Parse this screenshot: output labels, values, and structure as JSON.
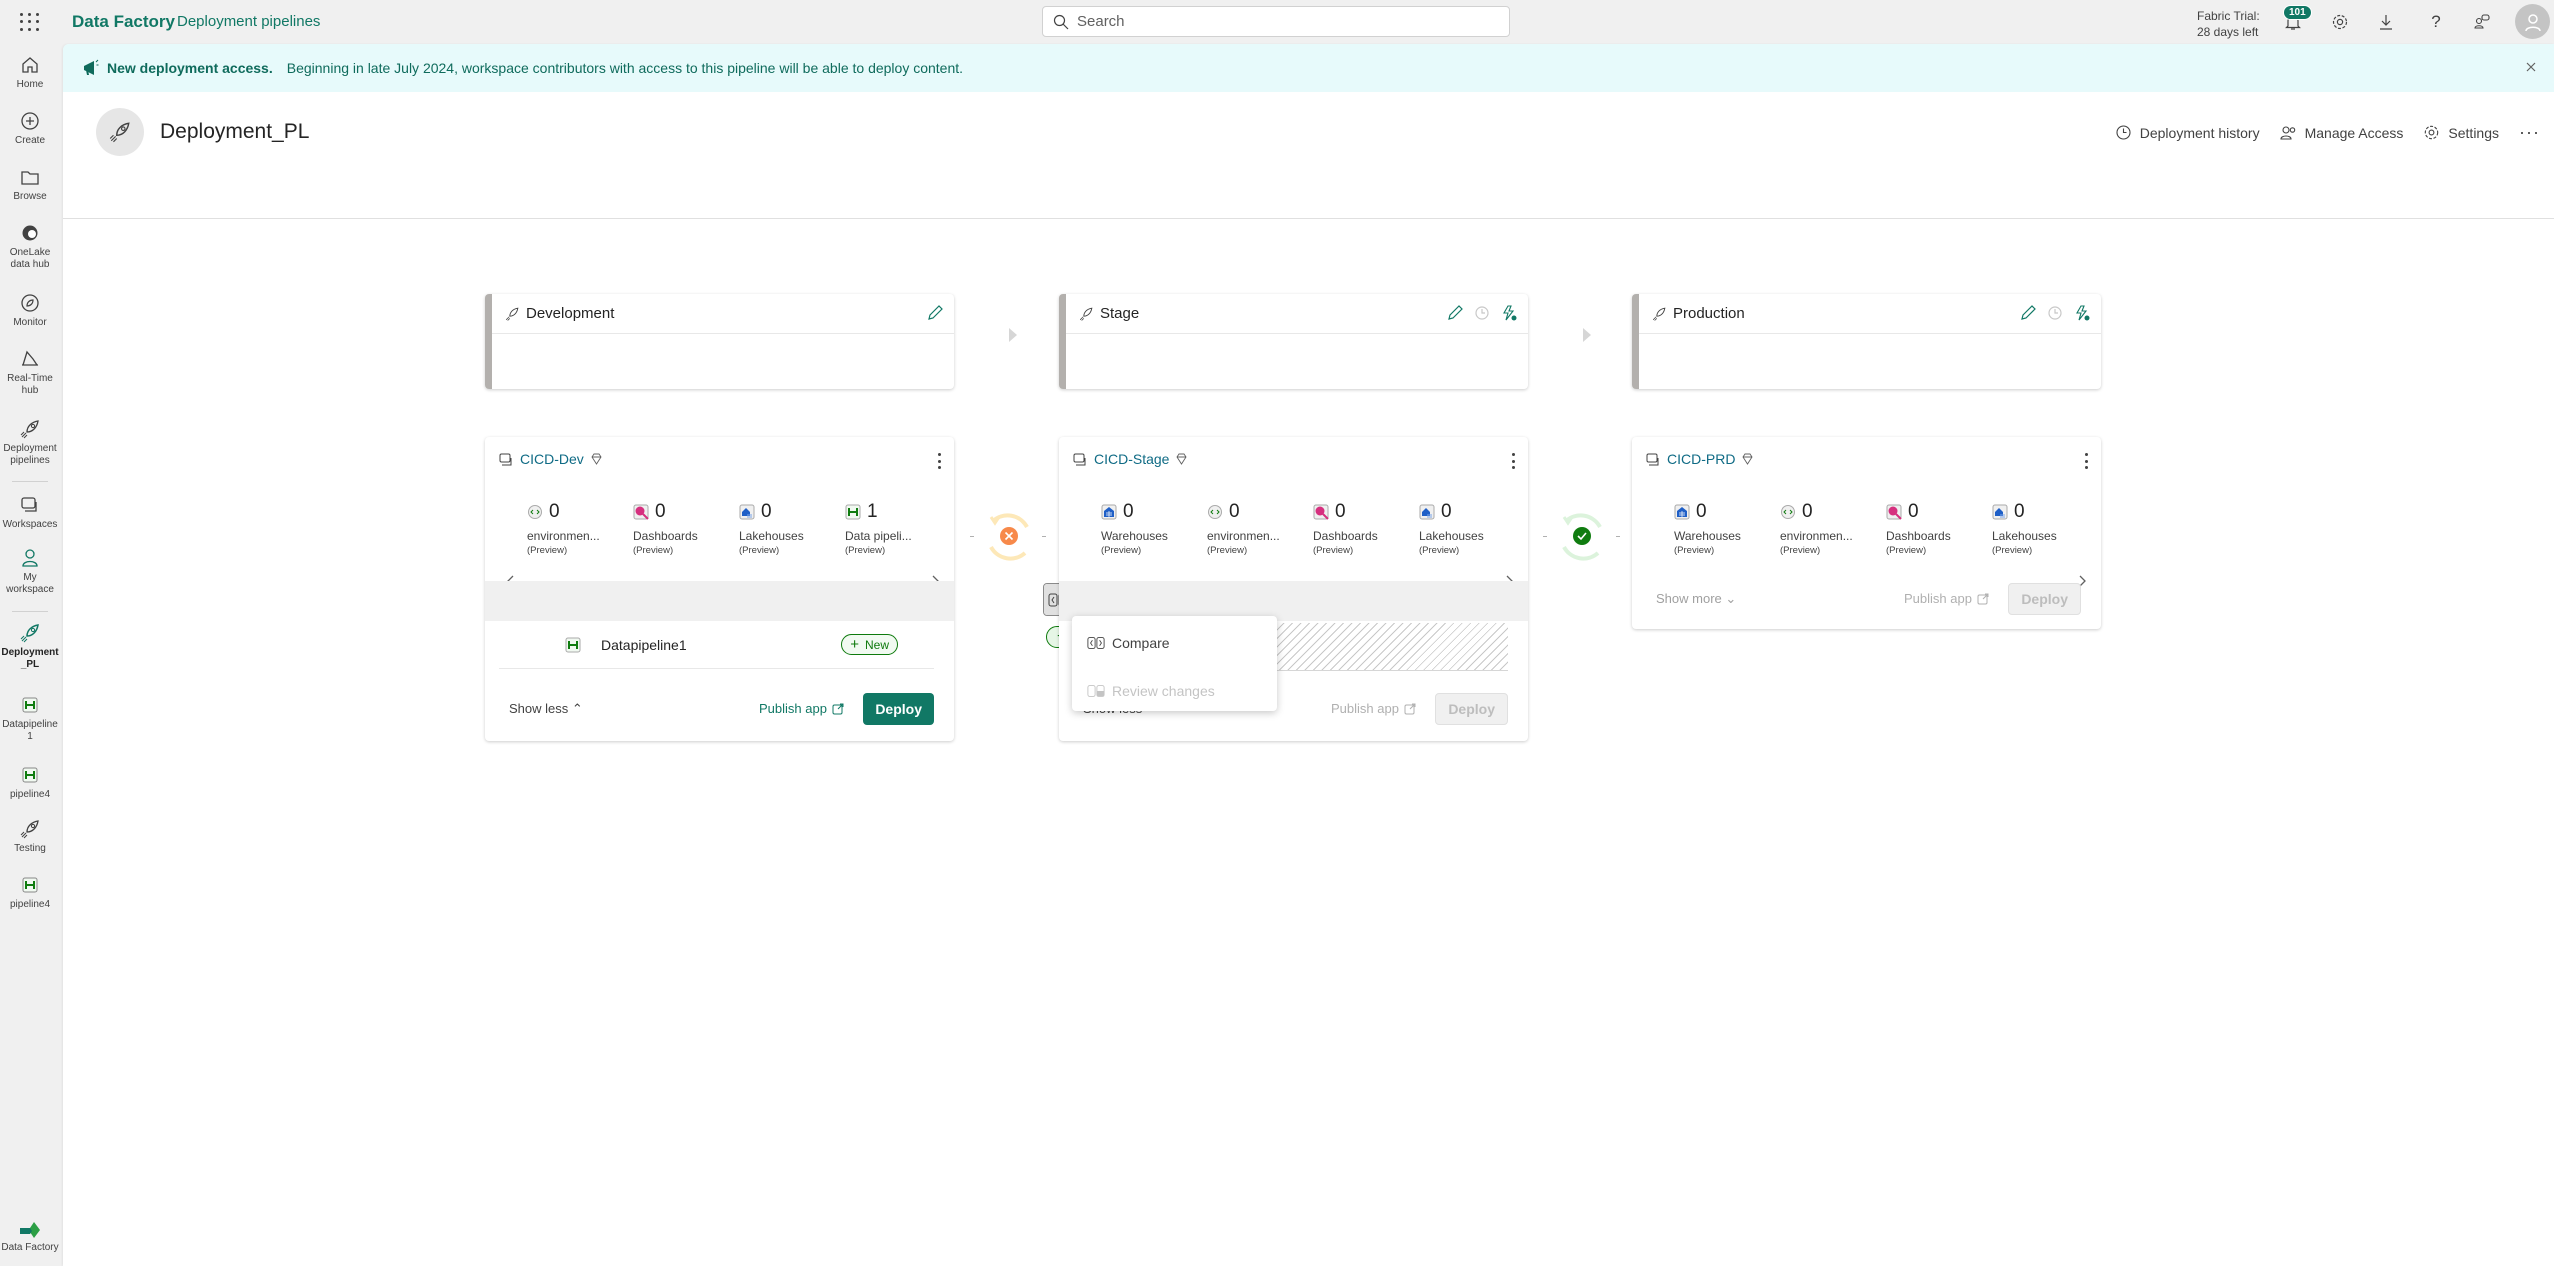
{
  "topbar": {
    "brand": "Data Factory",
    "section": "Deployment pipelines",
    "search_placeholder": "Search",
    "trial_line1": "Fabric Trial:",
    "trial_line2": "28 days left",
    "notification_count": "101"
  },
  "sidebar": {
    "items": [
      {
        "label": "Home",
        "icon": "home-icon"
      },
      {
        "label": "Create",
        "icon": "plus-circle-icon"
      },
      {
        "label": "Browse",
        "icon": "folder-icon"
      },
      {
        "label": "OneLake data hub",
        "icon": "onelake-icon"
      },
      {
        "label": "Monitor",
        "icon": "monitor-icon"
      },
      {
        "label": "Real-Time hub",
        "icon": "realtime-hub-icon"
      },
      {
        "label": "Deployment pipelines",
        "icon": "rocket-icon"
      },
      {
        "label": "Workspaces",
        "icon": "workspaces-icon"
      },
      {
        "label": "My workspace",
        "icon": "person-icon"
      },
      {
        "label": "Deployment _PL",
        "icon": "rocket-icon"
      },
      {
        "label": "Datapipeline 1",
        "icon": "pipeline-icon"
      },
      {
        "label": "pipeline4",
        "icon": "pipeline-icon"
      },
      {
        "label": "Testing",
        "icon": "rocket-icon"
      },
      {
        "label": "pipeline4",
        "icon": "pipeline-icon"
      }
    ],
    "footer_label": "Data Factory"
  },
  "banner": {
    "title": "New deployment access.",
    "text": "Beginning in late July 2024, workspace contributors with access to this pipeline will be able to deploy content."
  },
  "header": {
    "title": "Deployment_PL",
    "actions": {
      "history": "Deployment history",
      "access": "Manage Access",
      "settings": "Settings",
      "more": "···"
    }
  },
  "stages": [
    {
      "name": "Development"
    },
    {
      "name": "Stage"
    },
    {
      "name": "Production"
    }
  ],
  "workspaces": [
    {
      "name": "CICD-Dev",
      "stats": [
        {
          "count": "0",
          "name": "environmen...",
          "note": "(Preview)",
          "icon": "environment-icon"
        },
        {
          "count": "0",
          "name": "Dashboards",
          "note": "(Preview)",
          "icon": "dashboard-icon"
        },
        {
          "count": "0",
          "name": "Lakehouses",
          "note": "(Preview)",
          "icon": "lakehouse-icon"
        },
        {
          "count": "1",
          "name": "Data pipeli...",
          "note": "(Preview)",
          "icon": "pipeline-icon"
        }
      ],
      "items": [
        {
          "name": "Datapipeline1",
          "badge": "New"
        }
      ],
      "toggle": "Show less ⌃",
      "publish": "Publish app",
      "deploy": "Deploy"
    },
    {
      "name": "CICD-Stage",
      "stats": [
        {
          "count": "0",
          "name": "Warehouses",
          "note": "(Preview)",
          "icon": "warehouse-icon"
        },
        {
          "count": "0",
          "name": "environmen...",
          "note": "(Preview)",
          "icon": "environment-icon"
        },
        {
          "count": "0",
          "name": "Dashboards",
          "note": "(Preview)",
          "icon": "dashboard-icon"
        },
        {
          "count": "0",
          "name": "Lakehouses",
          "note": "(Preview)",
          "icon": "lakehouse-icon"
        }
      ],
      "toggle": "Show less ⌃",
      "publish": "Publish app",
      "deploy": "Deploy"
    },
    {
      "name": "CICD-PRD",
      "stats": [
        {
          "count": "0",
          "name": "Warehouses",
          "note": "(Preview)",
          "icon": "warehouse-icon"
        },
        {
          "count": "0",
          "name": "environmen...",
          "note": "(Preview)",
          "icon": "environment-icon"
        },
        {
          "count": "0",
          "name": "Dashboards",
          "note": "(Preview)",
          "icon": "dashboard-icon"
        },
        {
          "count": "0",
          "name": "Lakehouses",
          "note": "(Preview)",
          "icon": "lakehouse-icon"
        }
      ],
      "toggle": "Show more ⌄",
      "publish": "Publish app",
      "deploy": "Deploy"
    }
  ],
  "sync_status": [
    {
      "between": "Development-Stage",
      "status": "different",
      "color": "#f7894a"
    },
    {
      "between": "Stage-Production",
      "status": "in-sync",
      "color": "#107c10"
    }
  ],
  "compare_menu": {
    "items": [
      {
        "label": "Compare",
        "enabled": true
      },
      {
        "label": "Review changes",
        "enabled": false
      }
    ]
  },
  "colors": {
    "brand": "#117865",
    "banner_bg": "#e7fafb",
    "link": "#0f6b85"
  }
}
